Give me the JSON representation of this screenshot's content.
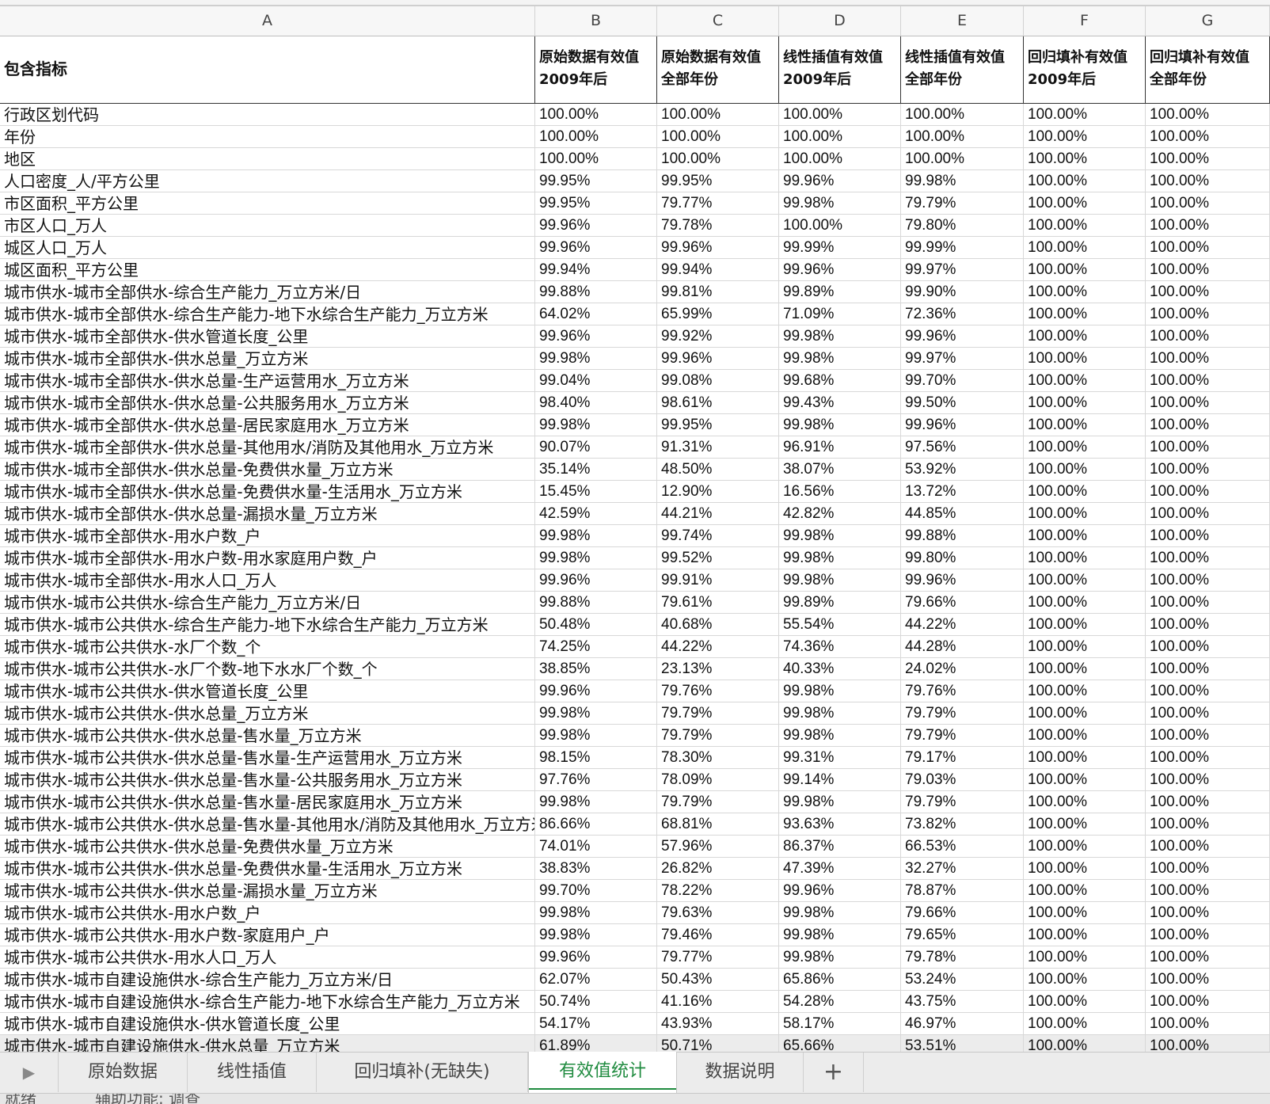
{
  "columns": [
    "A",
    "B",
    "C",
    "D",
    "E",
    "F",
    "G"
  ],
  "header": {
    "name": "包含指标",
    "cols": [
      [
        "原始数据有效值",
        "2009年后"
      ],
      [
        "原始数据有效值",
        "全部年份"
      ],
      [
        "线性插值有效值",
        "2009年后"
      ],
      [
        "线性插值有效值",
        "全部年份"
      ],
      [
        "回归填补有效值",
        "2009年后"
      ],
      [
        "回归填补有效值",
        "全部年份"
      ]
    ]
  },
  "rows": [
    [
      "行政区划代码",
      "100.00%",
      "100.00%",
      "100.00%",
      "100.00%",
      "100.00%",
      "100.00%"
    ],
    [
      "年份",
      "100.00%",
      "100.00%",
      "100.00%",
      "100.00%",
      "100.00%",
      "100.00%"
    ],
    [
      "地区",
      "100.00%",
      "100.00%",
      "100.00%",
      "100.00%",
      "100.00%",
      "100.00%"
    ],
    [
      "人口密度_人/平方公里",
      "99.95%",
      "99.95%",
      "99.96%",
      "99.98%",
      "100.00%",
      "100.00%"
    ],
    [
      "市区面积_平方公里",
      "99.95%",
      "79.77%",
      "99.98%",
      "79.79%",
      "100.00%",
      "100.00%"
    ],
    [
      "市区人口_万人",
      "99.96%",
      "79.78%",
      "100.00%",
      "79.80%",
      "100.00%",
      "100.00%"
    ],
    [
      "城区人口_万人",
      "99.96%",
      "99.96%",
      "99.99%",
      "99.99%",
      "100.00%",
      "100.00%"
    ],
    [
      "城区面积_平方公里",
      "99.94%",
      "99.94%",
      "99.96%",
      "99.97%",
      "100.00%",
      "100.00%"
    ],
    [
      "城市供水-城市全部供水-综合生产能力_万立方米/日",
      "99.88%",
      "99.81%",
      "99.89%",
      "99.90%",
      "100.00%",
      "100.00%"
    ],
    [
      "城市供水-城市全部供水-综合生产能力-地下水综合生产能力_万立方米",
      "64.02%",
      "65.99%",
      "71.09%",
      "72.36%",
      "100.00%",
      "100.00%"
    ],
    [
      "城市供水-城市全部供水-供水管道长度_公里",
      "99.96%",
      "99.92%",
      "99.98%",
      "99.96%",
      "100.00%",
      "100.00%"
    ],
    [
      "城市供水-城市全部供水-供水总量_万立方米",
      "99.98%",
      "99.96%",
      "99.98%",
      "99.97%",
      "100.00%",
      "100.00%"
    ],
    [
      "城市供水-城市全部供水-供水总量-生产运营用水_万立方米",
      "99.04%",
      "99.08%",
      "99.68%",
      "99.70%",
      "100.00%",
      "100.00%"
    ],
    [
      "城市供水-城市全部供水-供水总量-公共服务用水_万立方米",
      "98.40%",
      "98.61%",
      "99.43%",
      "99.50%",
      "100.00%",
      "100.00%"
    ],
    [
      "城市供水-城市全部供水-供水总量-居民家庭用水_万立方米",
      "99.98%",
      "99.95%",
      "99.98%",
      "99.96%",
      "100.00%",
      "100.00%"
    ],
    [
      "城市供水-城市全部供水-供水总量-其他用水/消防及其他用水_万立方米",
      "90.07%",
      "91.31%",
      "96.91%",
      "97.56%",
      "100.00%",
      "100.00%"
    ],
    [
      "城市供水-城市全部供水-供水总量-免费供水量_万立方米",
      "35.14%",
      "48.50%",
      "38.07%",
      "53.92%",
      "100.00%",
      "100.00%"
    ],
    [
      "城市供水-城市全部供水-供水总量-免费供水量-生活用水_万立方米",
      "15.45%",
      "12.90%",
      "16.56%",
      "13.72%",
      "100.00%",
      "100.00%"
    ],
    [
      "城市供水-城市全部供水-供水总量-漏损水量_万立方米",
      "42.59%",
      "44.21%",
      "42.82%",
      "44.85%",
      "100.00%",
      "100.00%"
    ],
    [
      "城市供水-城市全部供水-用水户数_户",
      "99.98%",
      "99.74%",
      "99.98%",
      "99.88%",
      "100.00%",
      "100.00%"
    ],
    [
      "城市供水-城市全部供水-用水户数-用水家庭用户数_户",
      "99.98%",
      "99.52%",
      "99.98%",
      "99.80%",
      "100.00%",
      "100.00%"
    ],
    [
      "城市供水-城市全部供水-用水人口_万人",
      "99.96%",
      "99.91%",
      "99.98%",
      "99.96%",
      "100.00%",
      "100.00%"
    ],
    [
      "城市供水-城市公共供水-综合生产能力_万立方米/日",
      "99.88%",
      "79.61%",
      "99.89%",
      "79.66%",
      "100.00%",
      "100.00%"
    ],
    [
      "城市供水-城市公共供水-综合生产能力-地下水综合生产能力_万立方米",
      "50.48%",
      "40.68%",
      "55.54%",
      "44.22%",
      "100.00%",
      "100.00%"
    ],
    [
      "城市供水-城市公共供水-水厂个数_个",
      "74.25%",
      "44.22%",
      "74.36%",
      "44.28%",
      "100.00%",
      "100.00%"
    ],
    [
      "城市供水-城市公共供水-水厂个数-地下水水厂个数_个",
      "38.85%",
      "23.13%",
      "40.33%",
      "24.02%",
      "100.00%",
      "100.00%"
    ],
    [
      "城市供水-城市公共供水-供水管道长度_公里",
      "99.96%",
      "79.76%",
      "99.98%",
      "79.76%",
      "100.00%",
      "100.00%"
    ],
    [
      "城市供水-城市公共供水-供水总量_万立方米",
      "99.98%",
      "79.79%",
      "99.98%",
      "79.79%",
      "100.00%",
      "100.00%"
    ],
    [
      "城市供水-城市公共供水-供水总量-售水量_万立方米",
      "99.98%",
      "79.79%",
      "99.98%",
      "79.79%",
      "100.00%",
      "100.00%"
    ],
    [
      "城市供水-城市公共供水-供水总量-售水量-生产运营用水_万立方米",
      "98.15%",
      "78.30%",
      "99.31%",
      "79.17%",
      "100.00%",
      "100.00%"
    ],
    [
      "城市供水-城市公共供水-供水总量-售水量-公共服务用水_万立方米",
      "97.76%",
      "78.09%",
      "99.14%",
      "79.03%",
      "100.00%",
      "100.00%"
    ],
    [
      "城市供水-城市公共供水-供水总量-售水量-居民家庭用水_万立方米",
      "99.98%",
      "79.79%",
      "99.98%",
      "79.79%",
      "100.00%",
      "100.00%"
    ],
    [
      "城市供水-城市公共供水-供水总量-售水量-其他用水/消防及其他用水_万立方米",
      "86.66%",
      "68.81%",
      "93.63%",
      "73.82%",
      "100.00%",
      "100.00%"
    ],
    [
      "城市供水-城市公共供水-供水总量-免费供水量_万立方米",
      "74.01%",
      "57.96%",
      "86.37%",
      "66.53%",
      "100.00%",
      "100.00%"
    ],
    [
      "城市供水-城市公共供水-供水总量-免费供水量-生活用水_万立方米",
      "38.83%",
      "26.82%",
      "47.39%",
      "32.27%",
      "100.00%",
      "100.00%"
    ],
    [
      "城市供水-城市公共供水-供水总量-漏损水量_万立方米",
      "99.70%",
      "78.22%",
      "99.96%",
      "78.87%",
      "100.00%",
      "100.00%"
    ],
    [
      "城市供水-城市公共供水-用水户数_户",
      "99.98%",
      "79.63%",
      "99.98%",
      "79.66%",
      "100.00%",
      "100.00%"
    ],
    [
      "城市供水-城市公共供水-用水户数-家庭用户_户",
      "99.98%",
      "79.46%",
      "99.98%",
      "79.65%",
      "100.00%",
      "100.00%"
    ],
    [
      "城市供水-城市公共供水-用水人口_万人",
      "99.96%",
      "79.77%",
      "99.98%",
      "79.78%",
      "100.00%",
      "100.00%"
    ],
    [
      "城市供水-城市自建设施供水-综合生产能力_万立方米/日",
      "62.07%",
      "50.43%",
      "65.86%",
      "53.24%",
      "100.00%",
      "100.00%"
    ],
    [
      "城市供水-城市自建设施供水-综合生产能力-地下水综合生产能力_万立方米",
      "50.74%",
      "41.16%",
      "54.28%",
      "43.75%",
      "100.00%",
      "100.00%"
    ],
    [
      "城市供水-城市自建设施供水-供水管道长度_公里",
      "54.17%",
      "43.93%",
      "58.17%",
      "46.97%",
      "100.00%",
      "100.00%"
    ],
    [
      "城市供水-城市自建设施供水-供水总量_万立方米",
      "61.89%",
      "50.71%",
      "65.66%",
      "53.51%",
      "100.00%",
      "100.00%"
    ]
  ],
  "tabs": [
    "原始数据",
    "线性插值",
    "回归填补(无缺失)",
    "有效值统计",
    "数据说明"
  ],
  "active_tab": "有效值统计",
  "status": "就绪",
  "status_extra": "辅助功能: 调查"
}
